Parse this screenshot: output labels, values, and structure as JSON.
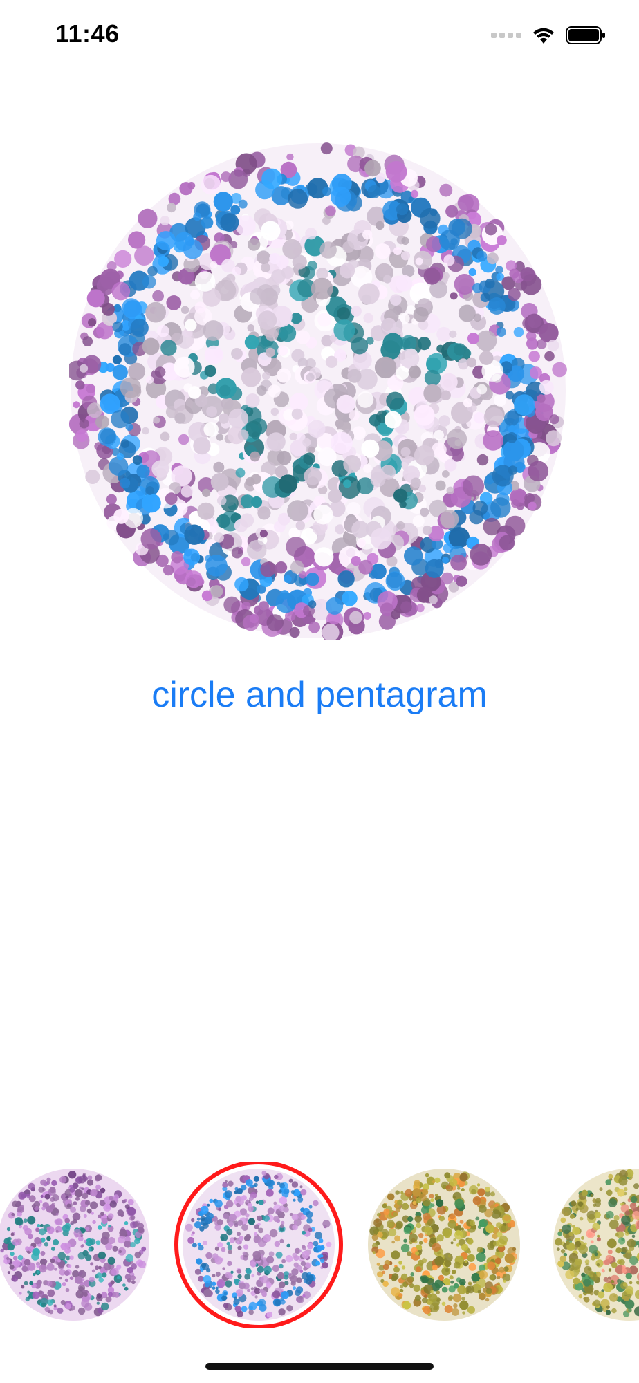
{
  "status_bar": {
    "time": "11:46",
    "icons": [
      "signal-icon",
      "wifi-icon",
      "battery-icon"
    ]
  },
  "main_plate": {
    "caption": "circle and pentagram",
    "colors": {
      "background_dots": "#e9d9ec",
      "outer_dots": "#a867b3",
      "figure_ring": "#2a8ee0",
      "figure_star": "#2b8c98"
    }
  },
  "thumbnails": [
    {
      "name": "plate-thumb-circles",
      "selected": false,
      "palette": [
        "#b07cc0",
        "#2f9ba0",
        "#1f4fb8"
      ]
    },
    {
      "name": "plate-thumb-circle-pentagram",
      "selected": true,
      "palette": [
        "#b88ac6",
        "#2a8ee0",
        "#2b8c98"
      ]
    },
    {
      "name": "plate-thumb-green-orange",
      "selected": false,
      "palette": [
        "#a9a33a",
        "#e28a3a",
        "#3d8a55"
      ]
    },
    {
      "name": "plate-thumb-olive-salmon",
      "selected": false,
      "palette": [
        "#a8a240",
        "#e58a7a",
        "#4a8a5a"
      ]
    }
  ],
  "colors": {
    "accent": "#1a7cf5",
    "selection_ring": "#ff1a1a"
  }
}
